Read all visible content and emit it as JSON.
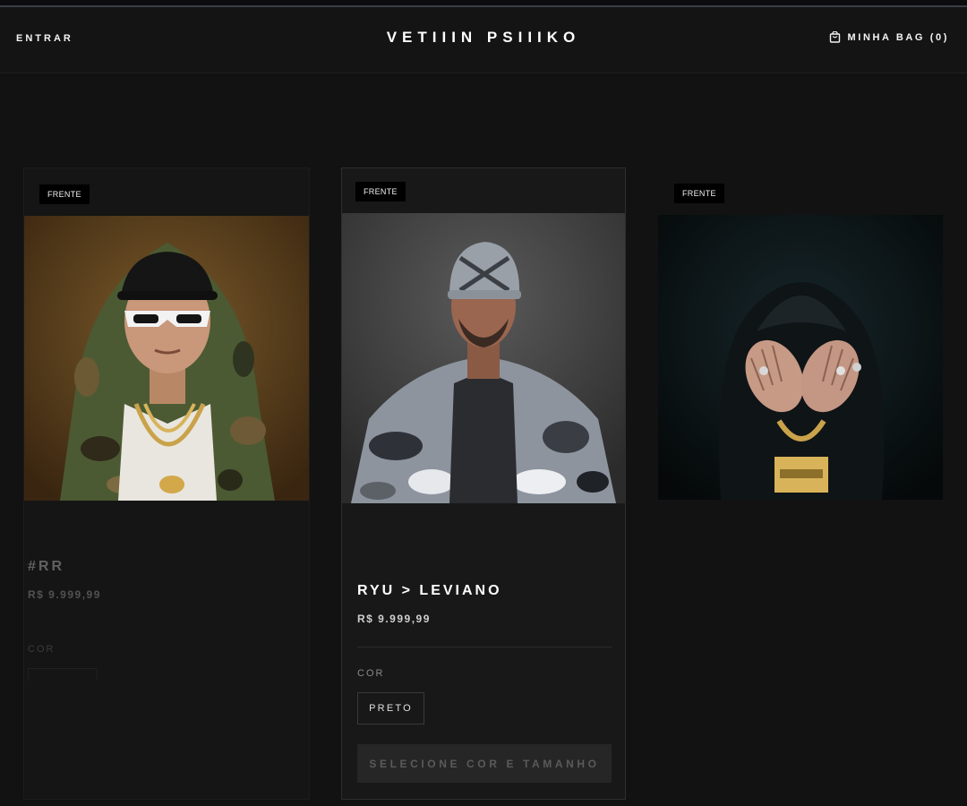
{
  "header": {
    "login_label": "ENTRAR",
    "brand": "VETIIIN PSIIIKO",
    "bag_label": "MINHA BAG (0)",
    "bag_icon": "shopping-bag-icon"
  },
  "products": [
    {
      "badge": "FRENTE",
      "name": "#RR",
      "price": "R$ 9.999,99",
      "color_label": "COR",
      "color_option": "PRETO"
    },
    {
      "badge": "FRENTE",
      "name": "RYU > LEVIANO",
      "price": "R$ 9.999,99",
      "color_label": "COR",
      "color_option": "PRETO",
      "action_label": "SELECIONE COR E TAMANHO"
    },
    {
      "badge": "FRENTE"
    }
  ],
  "colors": {
    "background": "#121212",
    "card": "#181818",
    "badge": "#000000",
    "disabled_button": "#262626"
  }
}
